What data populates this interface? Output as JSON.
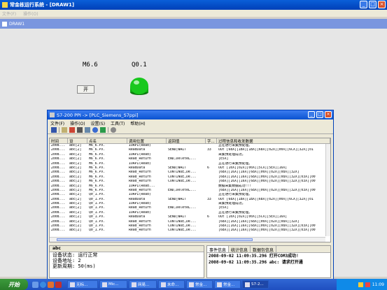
{
  "app": {
    "title": "常金栋运行系统 - [DRAW1]",
    "menu": [
      "文件(F)",
      "操作(O)"
    ],
    "mdi_title": "DRAW1"
  },
  "canvas": {
    "label_m": "M6.6",
    "label_q": "Q0.1",
    "start_button": "开",
    "lamp_color": "#19c81e"
  },
  "dialog": {
    "title": "S7-200 PPI -> [PLC_Siemens_S7ppi]",
    "menu": [
      "文件(F)",
      "操作(O)",
      "设置(S)",
      "工具(T)",
      "帮助(H)"
    ],
    "columns": [
      "时间",
      "设",
      "点名",
      "调用位置",
      "返回值",
      "字...",
      "过程信息和收发数据"
    ],
    "rows": [
      [
        "2008...",
        "abc[2]",
        "M6_6.PV.",
        "IOAPI(Read)",
        "",
        "",
        "正在进行采集预处理。"
      ],
      [
        "2008...",
        "abc[2]",
        "M6_6.PV.",
        "ReadData",
        "SEND|WAIT",
        "33",
        "Out [68X][1BX][1BX][68X][02X][00X][6CX][32X][01"
      ],
      [
        "2008...",
        "abc[2]",
        "M6_6.PV.",
        "IOAPI(Read)",
        "",
        "",
        "采集预处理成功。"
      ],
      [
        "2008...",
        "abc[2]",
        "M6_6.PV.",
        "Read_Return",
        "END,DeleteL...",
        "",
        "[E5X]"
      ],
      [
        "2008...",
        "abc[2]",
        "M6_6.PV.",
        "IOAPI(Read)",
        "",
        "",
        "正在进行采集预处理。"
      ],
      [
        "2008...",
        "abc[2]",
        "M6_6.PV.",
        "ReadData",
        "SEND|WAIT",
        "6",
        "Out [10X][02X][00X][5CX][5EX][16X]"
      ],
      [
        "2008...",
        "abc[2]",
        "M6_6.PV.",
        "Read_Return",
        "CONTINUE,De...",
        "",
        "[68X][16X][16X][68X][00X][02X][08X][32X]"
      ],
      [
        "2008...",
        "abc[2]",
        "M6_6.PV.",
        "Read_Return",
        "CONTINUE,De...",
        "",
        "[68X][16X][16X][68X][00X][02X][08X][32X][03X][00"
      ],
      [
        "2008...",
        "abc[2]",
        "M6_6.PV.",
        "Read_Return",
        "CONTINUE,De...",
        "",
        "[68X][16X][16X][68X][00X][02X][08X][32X][03X][00"
      ],
      [
        "2008...",
        "abc[2]",
        "M6_6.PV.",
        "IOAPI(Read...",
        "",
        "",
        "数据采集数据成功!!!"
      ],
      [
        "2008...",
        "abc[2]",
        "M6_6.PV.",
        "Read_Return",
        "END,DeleteL...",
        "",
        "[68X][16X][16X][68X][00X][02X][08X][32X][03X][00"
      ],
      [
        "2008...",
        "abc[2]",
        "Q0_1.PV.",
        "IOAPI(Read)",
        "",
        "",
        "正在进行采集预处理。"
      ],
      [
        "2008...",
        "abc[2]",
        "Q0_1.PV.",
        "ReadData",
        "SEND|WAIT",
        "33",
        "Out [68X][1BX][1BX][68X][02X][00X][6CX][32X][01"
      ],
      [
        "2008...",
        "abc[2]",
        "Q0_1.PV.",
        "IOAPI(Read)",
        "",
        "",
        "采集预处理成功。"
      ],
      [
        "2008...",
        "abc[2]",
        "Q0_1.PV.",
        "Read_Return",
        "END,DeleteL...",
        "",
        "[E5X]"
      ],
      [
        "2008...",
        "abc[2]",
        "Q0_1.PV.",
        "IOAPI(Read)",
        "",
        "",
        "正在进行采集预处理。"
      ],
      [
        "2008...",
        "abc[2]",
        "Q0_1.PV.",
        "ReadData",
        "SEND|WAIT",
        "6",
        "Out [10X][02X][00X][5CX][5EX][16X]"
      ],
      [
        "2008...",
        "abc[2]",
        "Q0_1.PV.",
        "Read_Return",
        "CONTINUE,De...",
        "",
        "[68X][16X][16X][68X][00X][02X][08X][32X]"
      ],
      [
        "2008...",
        "abc[2]",
        "Q0_1.PV.",
        "Read_Return",
        "CONTINUE,De...",
        "",
        "[68X][16X][16X][68X][00X][02X][08X][32X][03X][00"
      ],
      [
        "2008...",
        "abc[2]",
        "Q0_1.PV.",
        "Read_Return",
        "CONTINUE,De...",
        "",
        "[68X][16X][16X][68X][00X][02X][08X][32X][03X][00"
      ]
    ],
    "device_panel": {
      "title": "abc",
      "lines": [
        "设备状态: 运行正常",
        "设备地址: 2",
        "更新周期: 50(ms)"
      ]
    },
    "tabs": [
      "事件信息",
      "统计信息",
      "数据包信息"
    ],
    "events": [
      "2008-09-02 11:09:35.296  打开COM3成功!",
      "2008-09-02 11:09:35.296  abc: 请求打开通"
    ]
  },
  "taskbar": {
    "start": "开始",
    "tasks": [
      "无标...",
      "Mic...",
      "网易...",
      "未命...",
      "常金...",
      "常金...",
      "S7-2..."
    ],
    "clock": "11:09"
  }
}
